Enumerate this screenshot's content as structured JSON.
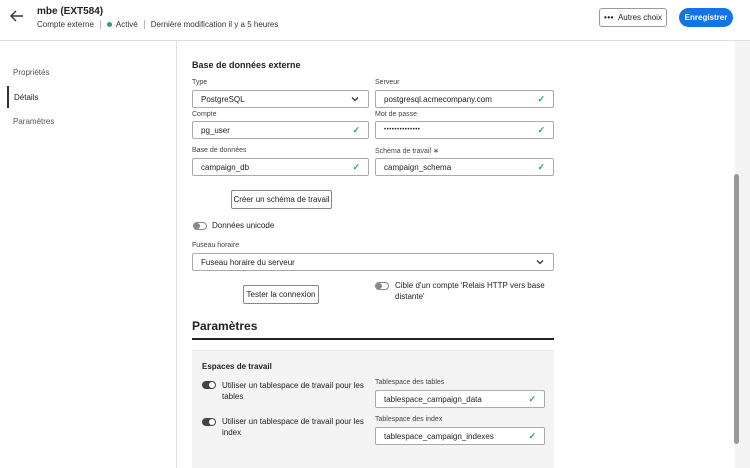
{
  "header": {
    "title": "mbe (EXT584)",
    "type": "Compte externe",
    "status": "Activé",
    "modified": "Dernière modification il y a 5 heures",
    "more_label": "Autres choix",
    "save_label": "Enregistrer",
    "status_color": "#2d9d78",
    "accent_color": "#1473e6"
  },
  "sidebar": {
    "items": [
      {
        "label": "Propriétés"
      },
      {
        "label": "Détails"
      },
      {
        "label": "Paramètres"
      }
    ]
  },
  "db": {
    "section_title": "Base de données externe",
    "type_label": "Type",
    "type_value": "PostgreSQL",
    "server_label": "Serveur",
    "server_value": "postgresql.acmecompany.com",
    "account_label": "Compte",
    "account_value": "pg_user",
    "password_label": "Mot de passe",
    "password_value": "••••••••••••••",
    "database_label": "Base de données",
    "database_value": "campaign_db",
    "schema_label": "Schéma de travail ∗",
    "schema_value": "campaign_schema",
    "create_schema_label": "Créer un schéma de travail",
    "unicode_label": "Données unicode",
    "unicode_on": false,
    "timezone_label": "Fuseau horaire",
    "timezone_value": "Fuseau horaire du serveur",
    "test_label": "Tester la connexion",
    "relay_label_1": "Cible d'un compte 'Relais HTTP vers base",
    "relay_label_2": "distante'",
    "relay_on": false
  },
  "params": {
    "title": "Paramètres",
    "workspaces_title": "Espaces de travail",
    "tables_toggle_1": "Utiliser un tablespace de travail pour les",
    "tables_toggle_2": "tables",
    "tables_toggle_on": true,
    "tables_label": "Tablespace des tables",
    "tables_value": "tablespace_campaign_data",
    "index_toggle_1": "Utiliser un tablespace de travail pour les",
    "index_toggle_2": "index",
    "index_toggle_on": true,
    "index_label": "Tablespace des index",
    "index_value": "tablespace_campaign_indexes"
  }
}
